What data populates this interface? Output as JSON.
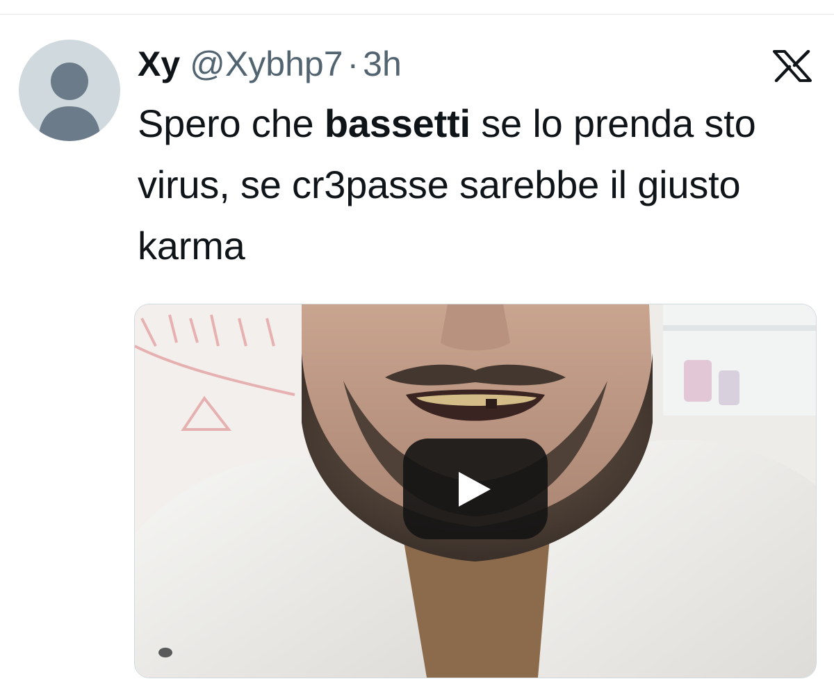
{
  "tweet": {
    "author": {
      "display_name": "Xy",
      "handle": "@Xybhp7",
      "avatar_icon": "default-avatar-icon"
    },
    "separator": "·",
    "timestamp": "3h",
    "platform_icon": "x-logo-icon",
    "text": {
      "part1": "Spero che ",
      "bold": "bassetti",
      "part2": " se lo prenda sto virus, se cr3passe sarebbe il giusto karma"
    },
    "media": {
      "type": "video",
      "play_icon": "play-icon"
    }
  },
  "colors": {
    "text_primary": "#0f1419",
    "text_secondary": "#536471",
    "avatar_bg": "#cfd9de",
    "avatar_figure": "#6b7b89"
  }
}
